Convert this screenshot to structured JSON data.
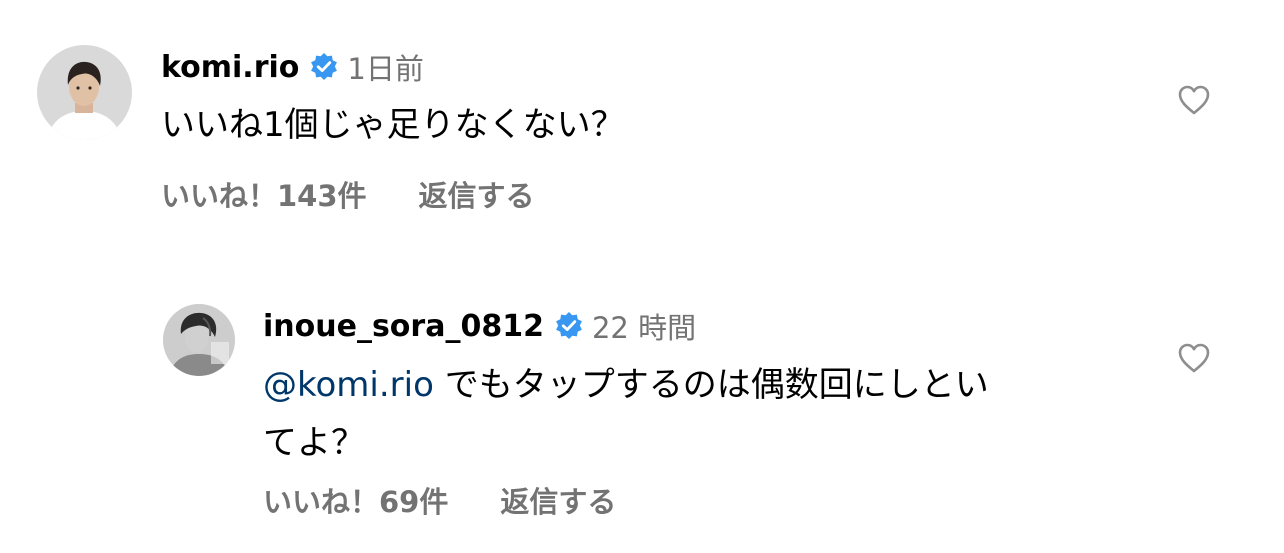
{
  "comments": [
    {
      "username": "komi.rio",
      "time": "1日前",
      "text": "いいね1個じゃ足りなくない？",
      "likes": "いいね！143件",
      "reply": "返信する",
      "verified_icon": "verified-badge-icon",
      "like_icon": "heart-outline-icon"
    },
    {
      "username": "inoue_sora_0812",
      "time": "22 時間",
      "mention": "@komi.rio",
      "text_line1": " でもタップするのは偶数回にしとい",
      "text_line2": "てよ？",
      "likes": "いいね！69件",
      "reply": "返信する",
      "verified_icon": "verified-badge-icon",
      "like_icon": "heart-outline-icon"
    }
  ],
  "colors": {
    "verified": "#3897f0",
    "secondary_text": "#737373",
    "mention": "#00376b",
    "icon": "#8e8e8e"
  }
}
